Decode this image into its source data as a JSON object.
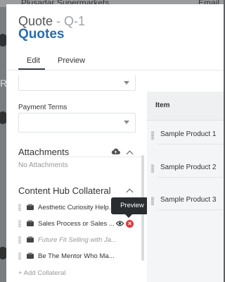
{
  "background": {
    "title_fragment": "Plusadar Supermarkets",
    "email_fragment": "Email",
    "left_fragment": "Re"
  },
  "header": {
    "subtitle_prefix": "Quote",
    "subtitle_id": " - Q-1",
    "title": "Quotes"
  },
  "tabs": [
    {
      "label": "Edit",
      "active": true
    },
    {
      "label": "Preview",
      "active": false
    }
  ],
  "payment_terms": {
    "label": "Payment Terms",
    "value": ""
  },
  "attachments": {
    "title": "Attachments",
    "empty_text": "No Attachments"
  },
  "collateral": {
    "title": "Content Hub Collateral",
    "items": [
      {
        "label": "Aesthetic Curiosity Help..."
      },
      {
        "label": "Sales Process or Sales ..."
      },
      {
        "label": "Future Fit Selling with Ja..."
      },
      {
        "label": "Be The Mentor Who Ma..."
      }
    ],
    "add_label": "+ Add Collateral",
    "tooltip": "Preview"
  },
  "items_panel": {
    "header": "Item",
    "items": [
      "Sample Product 1",
      "Sample Product 2",
      "Sample Product 3"
    ]
  },
  "colors": {
    "accent": "#2b6cb0",
    "danger": "#e03b3b",
    "tooltip_bg": "#2a2d30"
  }
}
